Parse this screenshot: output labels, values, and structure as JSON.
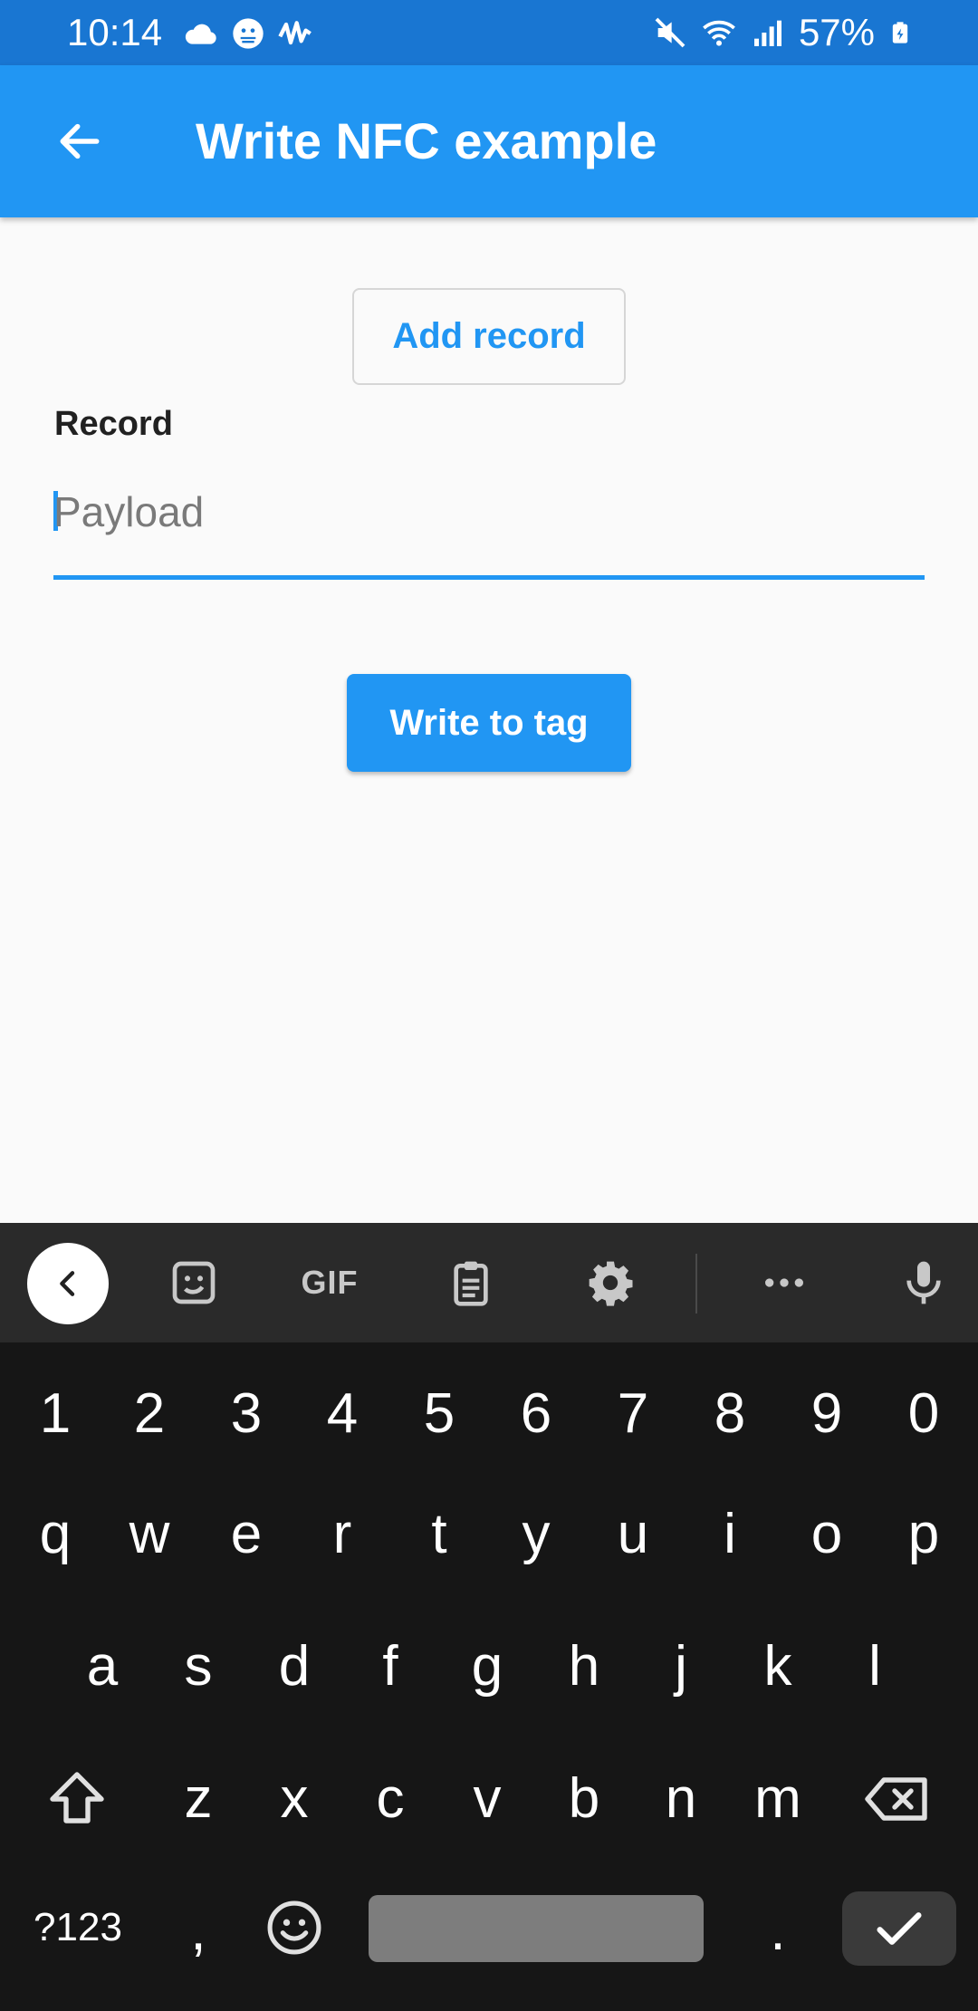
{
  "status_bar": {
    "time": "10:14",
    "battery_percent": "57%",
    "left_icons": [
      "cloud-icon",
      "weather-face-icon",
      "waveform-app-icon"
    ],
    "right_icons": [
      "mute-icon",
      "wifi-icon",
      "signal-icon",
      "battery-icon"
    ]
  },
  "app_bar": {
    "title": "Write NFC example",
    "back_icon": "arrow-back-icon",
    "color": "#2196f3"
  },
  "content": {
    "add_record_label": "Add record",
    "record_label": "Record",
    "payload_placeholder": "Payload",
    "payload_value": "",
    "write_button_label": "Write to tag"
  },
  "keyboard": {
    "toolbar_icons": [
      "collapse-icon",
      "sticker-icon",
      "gif-icon",
      "clipboard-icon",
      "settings-icon",
      "more-icon",
      "microphone-icon"
    ],
    "gif_label": "GIF",
    "row_numbers": [
      "1",
      "2",
      "3",
      "4",
      "5",
      "6",
      "7",
      "8",
      "9",
      "0"
    ],
    "row_1": [
      "q",
      "w",
      "e",
      "r",
      "t",
      "y",
      "u",
      "i",
      "o",
      "p"
    ],
    "row_2": [
      "a",
      "s",
      "d",
      "f",
      "g",
      "h",
      "j",
      "k",
      "l"
    ],
    "row_3": [
      "z",
      "x",
      "c",
      "v",
      "b",
      "n",
      "m"
    ],
    "symbols_label": "?123",
    "comma_label": ",",
    "period_label": ".",
    "shift_icon": "shift-icon",
    "backspace_icon": "backspace-icon",
    "emoji_icon": "emoji-icon",
    "enter_icon": "check-icon"
  },
  "colors": {
    "primary": "#2196f3",
    "status_bar": "#1976d2",
    "keyboard_bg": "#161616",
    "keyboard_toolbar": "#2a2a2a"
  }
}
